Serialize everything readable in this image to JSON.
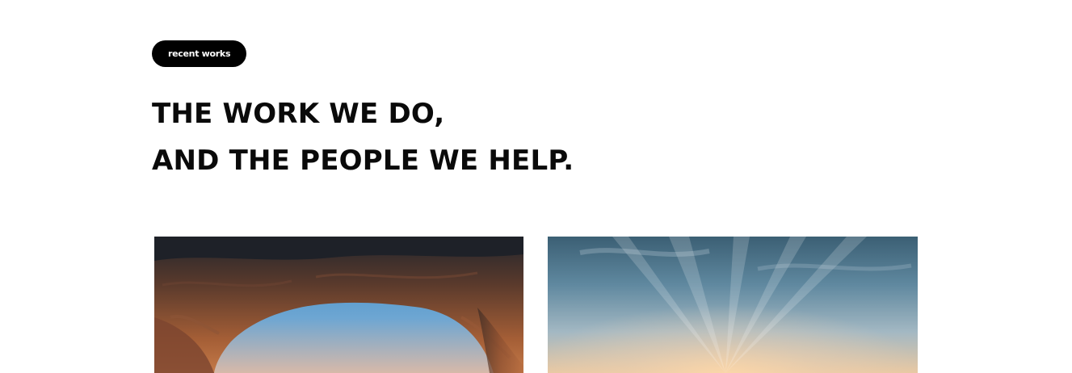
{
  "section": {
    "badge_label": "recent works",
    "heading_line1": "THE WORK WE DO,",
    "heading_line2": "AND THE PEOPLE WE HELP."
  },
  "projects": [
    {
      "image": "desert-rock-arch-photo"
    },
    {
      "image": "sunrise-sky-photo"
    }
  ],
  "colors": {
    "badge_bg": "#000000",
    "badge_text": "#ffffff",
    "heading": "#0a0a0a",
    "page_bg": "#ffffff"
  }
}
